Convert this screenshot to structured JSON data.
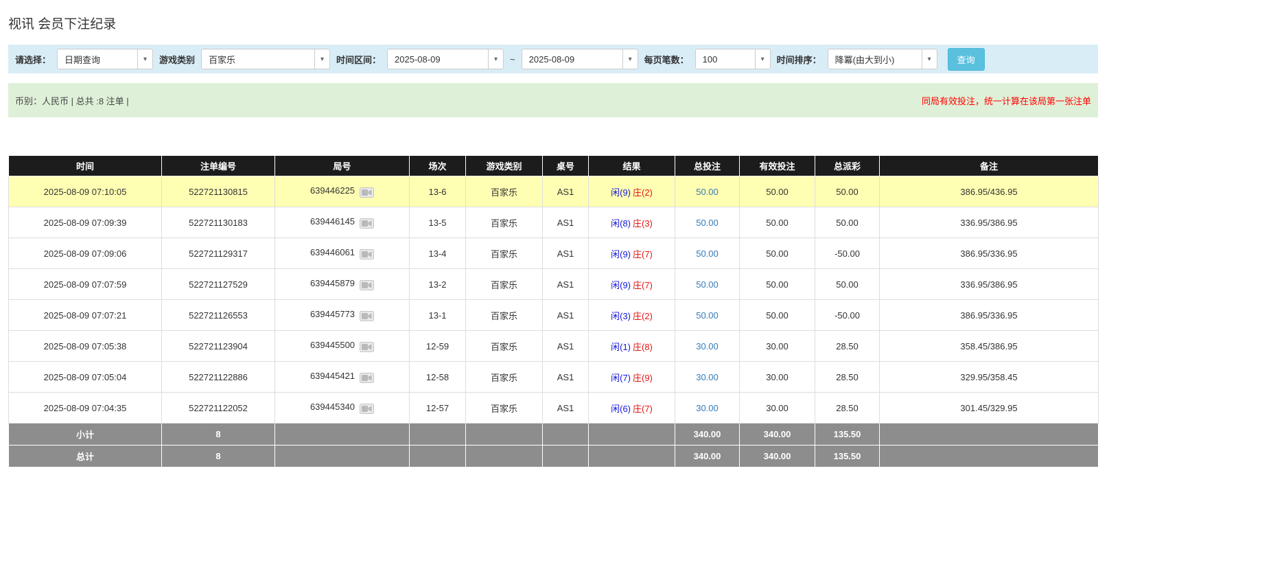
{
  "colors": {
    "filter_bg": "#d9edf7",
    "summary_bg": "#dff0d8",
    "header_bg": "#1c1c1c",
    "highlight_yellow": "#ffffb3",
    "footer_gray": "#8d8d8d",
    "link_blue": "#337ab7",
    "player_blue": "#1515d8",
    "banker_red": "#e01515",
    "negative_red": "#ff0000",
    "notice_red": "#ff0000",
    "search_btn_bg": "#5bc0de"
  },
  "page": {
    "title": "视讯 会员下注纪录"
  },
  "filters": {
    "select_label": "请选择：",
    "select_value": "日期查询",
    "game_type_label": "游戏类别",
    "game_type_value": "百家乐",
    "time_range_label": "时间区间：",
    "date_from": "2025-08-09",
    "range_separator": "~",
    "date_to": "2025-08-09",
    "page_size_label": "每页笔数：",
    "page_size_value": "100",
    "sort_label": "时间排序：",
    "sort_value": "降冪(由大到小)",
    "search_button": "查询",
    "caret": "▾"
  },
  "summary": {
    "currency_info": "币别：人民币 | 总共 :8 注单 |",
    "notice": "同局有效投注，统一计算在该局第一张注单"
  },
  "table": {
    "headers": [
      "时间",
      "注单编号",
      "局号",
      "场次",
      "游戏类别",
      "桌号",
      "结果",
      "总投注",
      "有效投注",
      "总派彩",
      "备注"
    ],
    "rows": [
      {
        "time": "2025-08-09 07:10:05",
        "bet_id": "522721130815",
        "round": "639446225",
        "session": "13-6",
        "game": "百家乐",
        "table_no": "AS1",
        "result_player": "闲(9)",
        "result_banker": "庄(2)",
        "total_bet": "50.00",
        "valid_bet": "50.00",
        "payout": "50.00",
        "note": "386.95/436.95",
        "highlight": true
      },
      {
        "time": "2025-08-09 07:09:39",
        "bet_id": "522721130183",
        "round": "639446145",
        "session": "13-5",
        "game": "百家乐",
        "table_no": "AS1",
        "result_player": "闲(8)",
        "result_banker": "庄(3)",
        "total_bet": "50.00",
        "valid_bet": "50.00",
        "payout": "50.00",
        "note": "336.95/386.95",
        "highlight": false
      },
      {
        "time": "2025-08-09 07:09:06",
        "bet_id": "522721129317",
        "round": "639446061",
        "session": "13-4",
        "game": "百家乐",
        "table_no": "AS1",
        "result_player": "闲(9)",
        "result_banker": "庄(7)",
        "total_bet": "50.00",
        "valid_bet": "50.00",
        "payout": "-50.00",
        "note": "386.95/336.95",
        "highlight": false
      },
      {
        "time": "2025-08-09 07:07:59",
        "bet_id": "522721127529",
        "round": "639445879",
        "session": "13-2",
        "game": "百家乐",
        "table_no": "AS1",
        "result_player": "闲(9)",
        "result_banker": "庄(7)",
        "total_bet": "50.00",
        "valid_bet": "50.00",
        "payout": "50.00",
        "note": "336.95/386.95",
        "highlight": false
      },
      {
        "time": "2025-08-09 07:07:21",
        "bet_id": "522721126553",
        "round": "639445773",
        "session": "13-1",
        "game": "百家乐",
        "table_no": "AS1",
        "result_player": "闲(3)",
        "result_banker": "庄(2)",
        "total_bet": "50.00",
        "valid_bet": "50.00",
        "payout": "-50.00",
        "note": "386.95/336.95",
        "highlight": false
      },
      {
        "time": "2025-08-09 07:05:38",
        "bet_id": "522721123904",
        "round": "639445500",
        "session": "12-59",
        "game": "百家乐",
        "table_no": "AS1",
        "result_player": "闲(1)",
        "result_banker": "庄(8)",
        "total_bet": "30.00",
        "valid_bet": "30.00",
        "payout": "28.50",
        "note": "358.45/386.95",
        "highlight": false
      },
      {
        "time": "2025-08-09 07:05:04",
        "bet_id": "522721122886",
        "round": "639445421",
        "session": "12-58",
        "game": "百家乐",
        "table_no": "AS1",
        "result_player": "闲(7)",
        "result_banker": "庄(9)",
        "total_bet": "30.00",
        "valid_bet": "30.00",
        "payout": "28.50",
        "note": "329.95/358.45",
        "highlight": false
      },
      {
        "time": "2025-08-09 07:04:35",
        "bet_id": "522721122052",
        "round": "639445340",
        "session": "12-57",
        "game": "百家乐",
        "table_no": "AS1",
        "result_player": "闲(6)",
        "result_banker": "庄(7)",
        "total_bet": "30.00",
        "valid_bet": "30.00",
        "payout": "28.50",
        "note": "301.45/329.95",
        "highlight": false
      }
    ],
    "subtotal": {
      "label": "小计",
      "count": "8",
      "total_bet": "340.00",
      "valid_bet": "340.00",
      "payout": "135.50"
    },
    "total": {
      "label": "总计",
      "count": "8",
      "total_bet": "340.00",
      "valid_bet": "340.00",
      "payout": "135.50"
    }
  }
}
